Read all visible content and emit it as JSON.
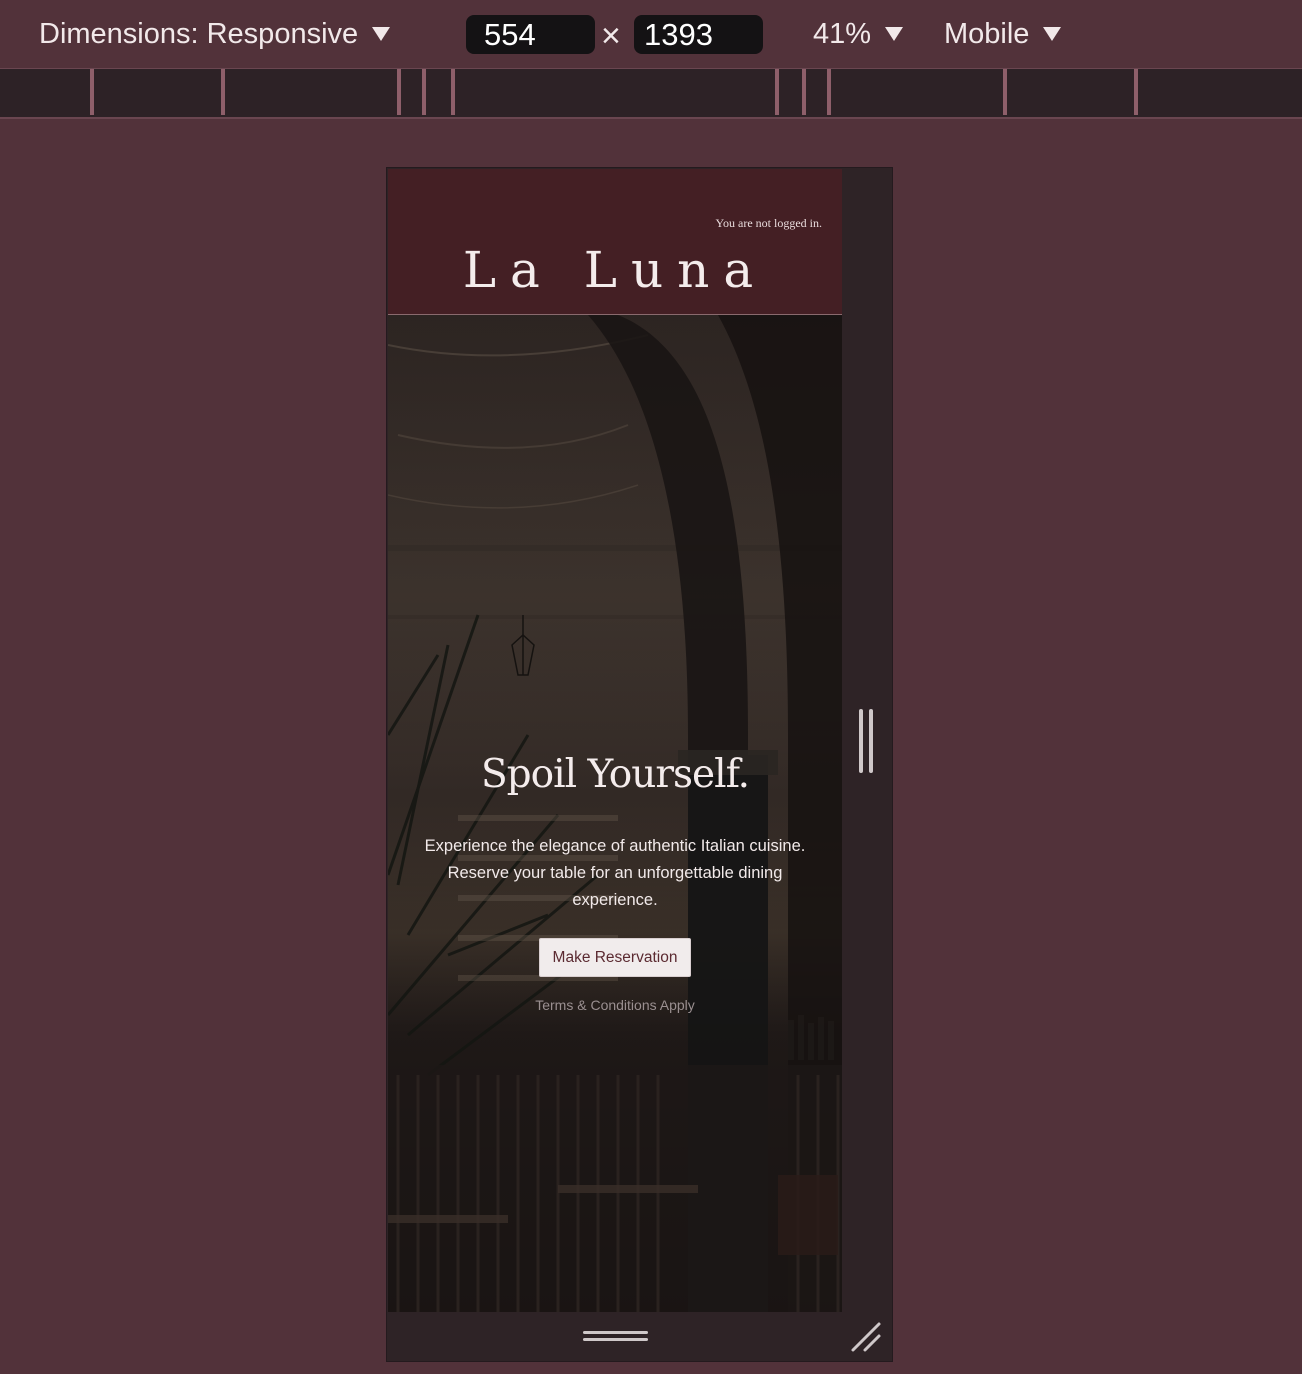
{
  "toolbar": {
    "dimensions_label": "Dimensions: Responsive",
    "width_value": "554",
    "times_symbol": "×",
    "height_value": "1393",
    "zoom_label": "41%",
    "device_label": "Mobile",
    "dropdown_icon": "triangle-down-icon"
  },
  "site": {
    "login_status": "You are not logged in.",
    "brand": "La Luna"
  },
  "hero": {
    "title": "Spoil Yourself.",
    "description": "Experience the elegance of authentic Italian cuisine. Reserve your table for an unforgettable dining experience.",
    "cta_label": "Make Reservation",
    "terms_label": "Terms & Conditions Apply"
  },
  "colors": {
    "page_background": "#52323a",
    "header_background": "#441f24",
    "button_background": "#f1ecec",
    "button_text": "#5b2a31"
  }
}
